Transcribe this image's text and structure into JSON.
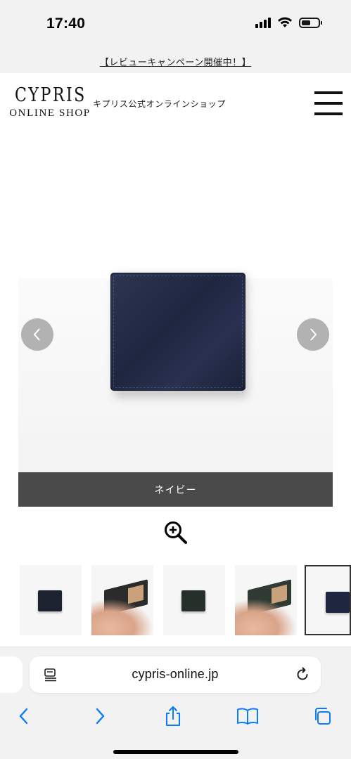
{
  "status_bar": {
    "time": "17:40",
    "icons": [
      "cellular-signal-icon",
      "wifi-icon",
      "battery-icon"
    ]
  },
  "campaign_banner": {
    "text": "【レビューキャンペーン開催中！】"
  },
  "header": {
    "logo_main": "CYPRIS",
    "logo_sub": "ONLINE SHOP",
    "tagline": "キプリス公式オンラインショップ",
    "menu_icon": "hamburger-menu-icon"
  },
  "product_slider": {
    "current_color": "ネイビー",
    "prev_icon": "chevron-left-icon",
    "next_icon": "chevron-right-icon",
    "zoom_icon": "zoom-in-icon",
    "thumbnails": [
      {
        "name": "black-wallet-front"
      },
      {
        "name": "black-wallet-open-in-hands"
      },
      {
        "name": "green-wallet-front"
      },
      {
        "name": "green-wallet-open-in-hands"
      },
      {
        "name": "navy-wallet-front",
        "selected": true
      }
    ]
  },
  "browser": {
    "url": "cypris-online.jp",
    "toolbar": [
      "back-icon",
      "forward-icon",
      "share-icon",
      "bookmarks-icon",
      "tabs-icon"
    ]
  },
  "colors": {
    "status_background": "#f2f2f2",
    "caption_bar": "#4a4a4a",
    "wallet_navy": "#1f2640",
    "ios_blue": "#0a7aff"
  }
}
